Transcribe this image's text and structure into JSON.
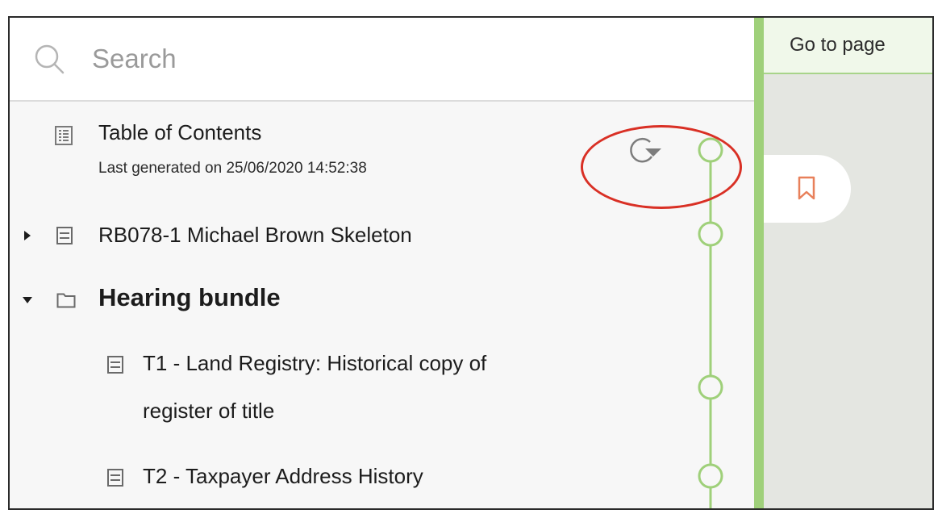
{
  "search": {
    "placeholder": "Search",
    "value": ""
  },
  "toc": {
    "title": "Table of Contents",
    "subtitle": "Last generated on 25/06/2020 14:52:38",
    "refresh_icon": "refresh-icon"
  },
  "items": [
    {
      "label": "RB078-1 Michael Brown Skeleton",
      "type": "document",
      "expanded": false
    },
    {
      "label": "Hearing bundle",
      "type": "folder",
      "expanded": true
    },
    {
      "label_line1": "T1 - Land Registry: Historical copy of",
      "label_line2": "register of title",
      "type": "document"
    },
    {
      "label": "T2 - Taxpayer Address History",
      "type": "document"
    }
  ],
  "right_panel": {
    "goto_label": "Go to page",
    "bookmark_icon": "bookmark-icon"
  },
  "colors": {
    "timeline": "#9fd07a",
    "bookmark": "#e8805a",
    "highlight": "#d93025"
  }
}
